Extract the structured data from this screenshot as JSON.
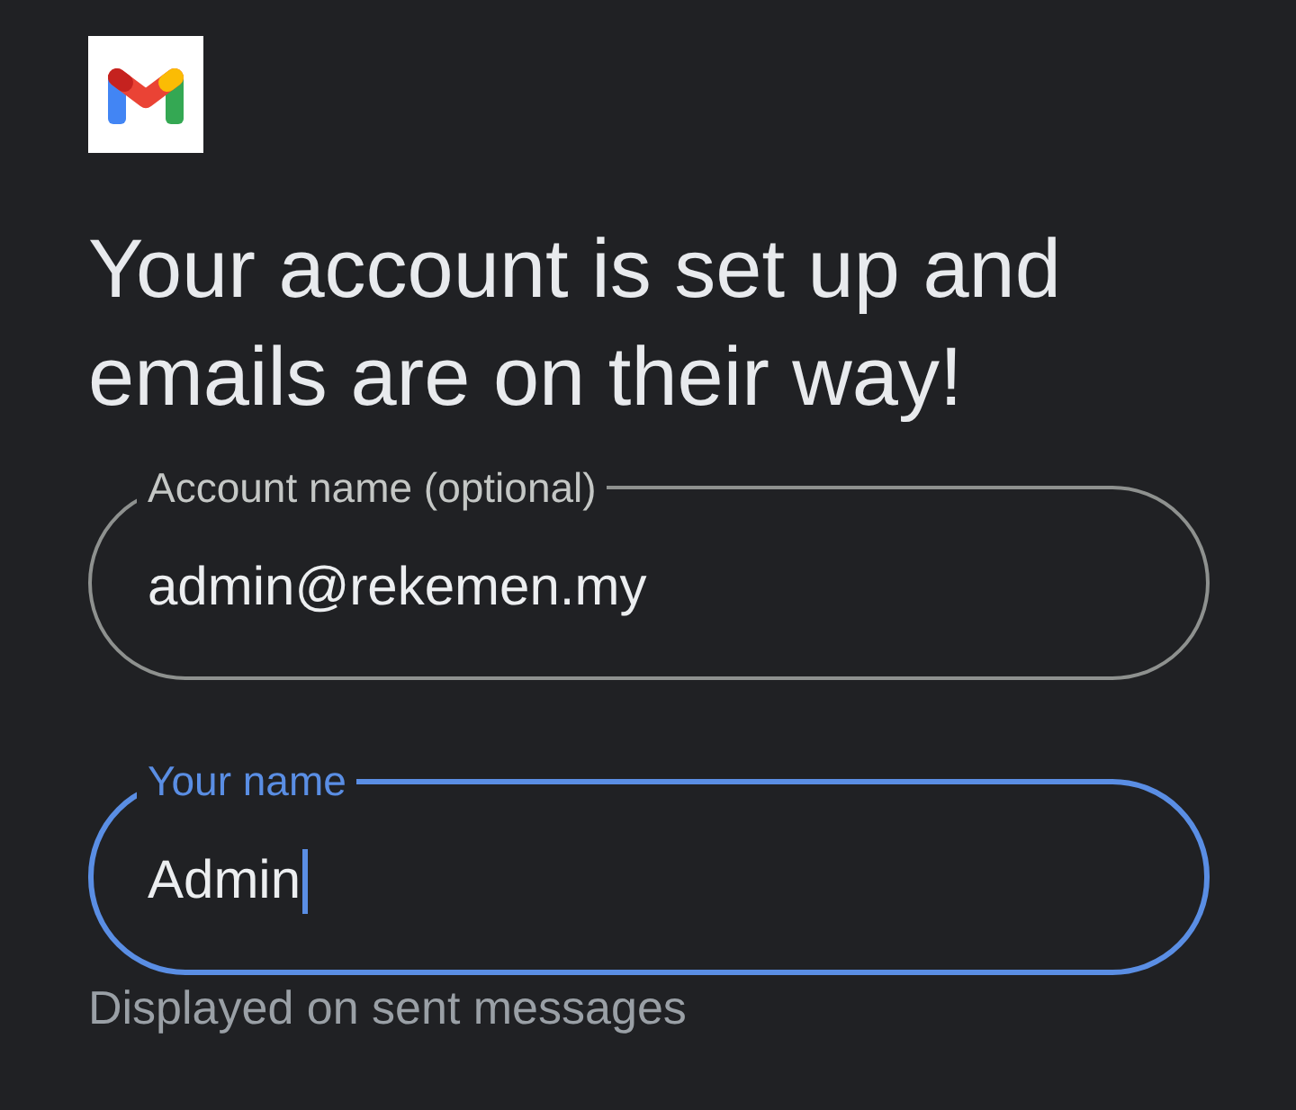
{
  "title": "Your account is set up and emails are on their way!",
  "fields": [
    {
      "label": "Account name (optional)",
      "value": "admin@rekemen.my",
      "focused": false
    },
    {
      "label": "Your name",
      "value": "Admin",
      "focused": true,
      "helper": "Displayed on sent messages"
    }
  ]
}
